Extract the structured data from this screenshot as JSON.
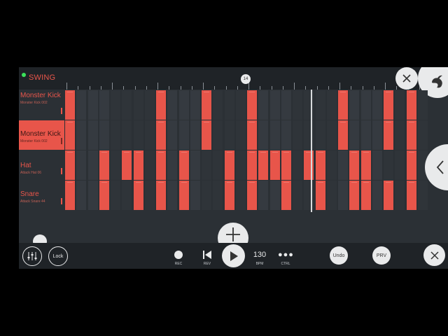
{
  "header": {
    "swing_label": "SWING",
    "marker_label": "14"
  },
  "channels": [
    {
      "name": "Monster Kick",
      "sub": "Monster Kick 002",
      "selected": false
    },
    {
      "name": "Monster Kick",
      "sub": "Monster Kick 002",
      "selected": true
    },
    {
      "name": "Hat",
      "sub": "Attack Hat 06",
      "selected": false
    },
    {
      "name": "Snare",
      "sub": "Attack Snare 44",
      "selected": false
    }
  ],
  "pattern": [
    [
      1,
      0,
      0,
      0,
      0,
      0,
      0,
      0,
      1,
      0,
      0,
      0,
      1,
      0,
      0,
      0,
      1,
      0,
      0,
      0,
      0,
      0,
      0,
      0,
      1,
      0,
      0,
      0,
      1,
      0,
      1,
      0
    ],
    [
      1,
      0,
      0,
      0,
      0,
      0,
      0,
      0,
      1,
      0,
      0,
      0,
      1,
      0,
      0,
      0,
      1,
      0,
      0,
      0,
      0,
      0,
      0,
      0,
      1,
      0,
      0,
      0,
      1,
      0,
      1,
      0
    ],
    [
      1,
      0,
      0,
      1,
      0,
      1,
      1,
      0,
      1,
      0,
      1,
      0,
      0,
      0,
      1,
      0,
      1,
      1,
      1,
      1,
      0,
      1,
      1,
      0,
      0,
      1,
      1,
      0,
      0,
      0,
      1,
      0
    ],
    [
      1,
      0,
      0,
      1,
      0,
      0,
      1,
      0,
      1,
      0,
      1,
      0,
      0,
      0,
      1,
      0,
      1,
      0,
      0,
      1,
      0,
      0,
      1,
      0,
      0,
      1,
      1,
      0,
      1,
      0,
      1,
      0
    ]
  ],
  "transport": {
    "lock_label": "Lock",
    "rec_label": "REC",
    "rev_label": "REV",
    "bpm_value": "130",
    "bpm_label": "BPM",
    "ctrl_label": "CTRL",
    "undo_label": "Undo",
    "prv_label": "PRV"
  },
  "colors": {
    "accent": "#e8554a",
    "background": "#2b3035",
    "bar": "#1f2327"
  }
}
